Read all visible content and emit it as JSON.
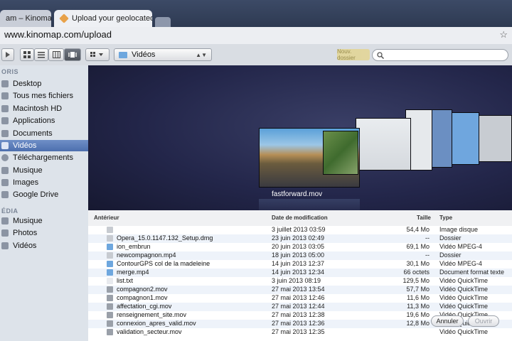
{
  "browser": {
    "tabs": [
      {
        "label": "am – Kinoma",
        "close": "×"
      },
      {
        "label": "Upload your geolocated vi",
        "close": "×"
      }
    ],
    "url": "www.kinomap.com/upload",
    "star": "☆"
  },
  "toolbar": {
    "folder_popup": "Vidéos",
    "new_folder": "Nouv. dossier",
    "search_placeholder": ""
  },
  "sidebar": {
    "favorites_title": "ORIS",
    "items": [
      {
        "label": "Desktop"
      },
      {
        "label": "Tous mes fichiers"
      },
      {
        "label": "Macintosh HD"
      },
      {
        "label": "Applications"
      },
      {
        "label": "Documents"
      },
      {
        "label": "Vidéos",
        "selected": true
      },
      {
        "label": "Téléchargements"
      },
      {
        "label": "Musique"
      },
      {
        "label": "Images"
      },
      {
        "label": "Google Drive"
      }
    ],
    "media_title": "ÉDIA",
    "media_items": [
      {
        "label": "Musique"
      },
      {
        "label": "Photos"
      },
      {
        "label": "Vidéos"
      }
    ]
  },
  "coverflow": {
    "selected_file": "fastforward.mov"
  },
  "table": {
    "headers": {
      "name": "Antérieur",
      "date": "Date de modification",
      "size": "Taille",
      "type": "Type"
    },
    "rows": [
      {
        "name": "",
        "date": "3 juillet 2013 03:59",
        "size": "54,4 Mo",
        "type": "Image disque",
        "icon": "#c7cbd1"
      },
      {
        "name": "Opera_15.0.1147.132_Setup.dmg",
        "date": "23 juin 2013 02:49",
        "size": "--",
        "type": "Dossier",
        "icon": "#c7cbd1"
      },
      {
        "name": "ion_embrun",
        "date": "20 juin 2013 03:05",
        "size": "69,1 Mo",
        "type": "Vidéo MPEG-4",
        "icon": "#6ea7de"
      },
      {
        "name": "newcompagnon.mp4",
        "date": "18 juin 2013 05:00",
        "size": "--",
        "type": "Dossier",
        "icon": "#c7cbd1"
      },
      {
        "name": "ContourGPS col de la madeleine",
        "date": "14 juin 2013 12:37",
        "size": "30,1 Mo",
        "type": "Vidéo MPEG-4",
        "icon": "#6ea7de"
      },
      {
        "name": "merge.mp4",
        "date": "14 juin 2013 12:34",
        "size": "66 octets",
        "type": "Document format texte",
        "icon": "#6ea7de"
      },
      {
        "name": "list.txt",
        "date": "3 juin 2013 08:19",
        "size": "129,5 Mo",
        "type": "Vidéo QuickTime",
        "icon": "#e8eaee"
      },
      {
        "name": "compagnon2.mov",
        "date": "27 mai 2013 13:54",
        "size": "57,7 Mo",
        "type": "Vidéo QuickTime",
        "icon": "#9aa0a9"
      },
      {
        "name": "compagnon1.mov",
        "date": "27 mai 2013 12:46",
        "size": "11,6 Mo",
        "type": "Vidéo QuickTime",
        "icon": "#9aa0a9"
      },
      {
        "name": "affectation_cgi.mov",
        "date": "27 mai 2013 12:44",
        "size": "11,3 Mo",
        "type": "Vidéo QuickTime",
        "icon": "#9aa0a9"
      },
      {
        "name": "renseignement_site.mov",
        "date": "27 mai 2013 12:38",
        "size": "19,6 Mo",
        "type": "Vidéo QuickTime",
        "icon": "#9aa0a9"
      },
      {
        "name": "connexion_apres_valid.mov",
        "date": "27 mai 2013 12:36",
        "size": "12,8 Mo",
        "type": "Vidéo QuickTime",
        "icon": "#9aa0a9"
      },
      {
        "name": "validation_secteur.mov",
        "date": "27 mai 2013 12:35",
        "size": "",
        "type": "Vidéo QuickTime",
        "icon": "#9aa0a9"
      }
    ]
  },
  "buttons": {
    "cancel": "Annuler",
    "open": "Ouvrir"
  }
}
